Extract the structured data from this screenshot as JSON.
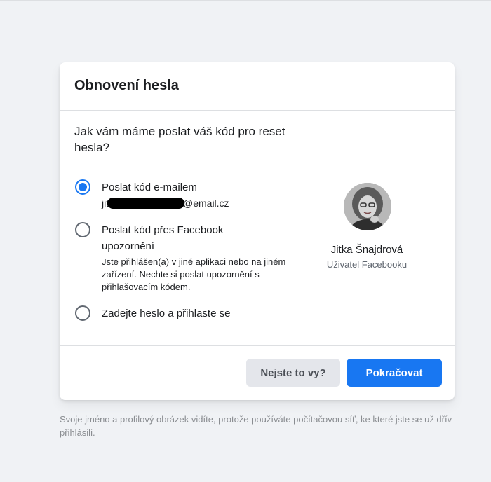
{
  "card": {
    "title": "Obnovení hesla",
    "question": "Jak vám máme poslat váš kód pro reset hesla?",
    "options": [
      {
        "label": "Poslat kód e-mailem",
        "email_prefix": "jit",
        "email_domain": "@email.cz",
        "checked": true
      },
      {
        "label": "Poslat kód přes Facebook upozornění",
        "description": "Jste přihlášen(a) v jiné aplikaci nebo na jiném zařízení. Nechte si poslat upozornění s přihlašovacím kódem.",
        "checked": false
      },
      {
        "label": "Zadejte heslo a přihlaste se",
        "checked": false
      }
    ]
  },
  "profile": {
    "name": "Jitka Šnajdrová",
    "subtitle": "Uživatel Facebooku"
  },
  "footer": {
    "not_you_label": "Nejste to vy?",
    "continue_label": "Pokračovat"
  },
  "note": "Svoje jméno a profilový obrázek vidíte, protože používáte počítačovou síť, ke které jste se už dřív přihlásili.",
  "colors": {
    "accent": "#1877f2",
    "background": "#f0f2f5",
    "secondary_button": "#e4e6eb"
  }
}
